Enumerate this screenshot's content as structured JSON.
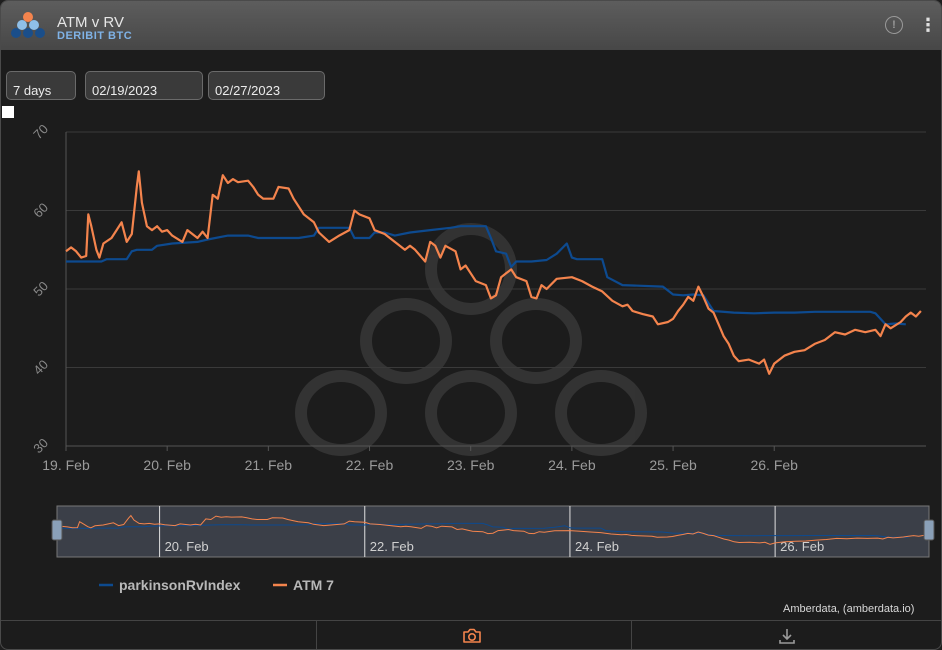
{
  "header": {
    "title": "ATM v RV",
    "subtitle": "DERIBIT BTC",
    "info_symbol": "!",
    "more_symbol": "⋮"
  },
  "controls": {
    "period_value": "7 days",
    "start_date": "02/19/2023",
    "end_date": "02/27/2023"
  },
  "credit": "Amberdata, (amberdata.io)",
  "footer": {
    "camera_icon": "camera-icon",
    "download_icon": "download-icon"
  },
  "colors": {
    "rv": "#0d4a8f",
    "atm": "#f4844d",
    "grid": "#3a3a3a"
  },
  "chart_data": {
    "type": "line",
    "x_unit": "days since 19 Feb 2023 00:00",
    "ylim": [
      30,
      70
    ],
    "y_ticks": [
      30,
      40,
      50,
      60,
      70
    ],
    "x_tick_labels": [
      "19. Feb",
      "20. Feb",
      "21. Feb",
      "22. Feb",
      "23. Feb",
      "24. Feb",
      "25. Feb",
      "26. Feb"
    ],
    "navigator_labels": [
      "20. Feb",
      "22. Feb",
      "24. Feb",
      "26. Feb"
    ],
    "series": [
      {
        "name": "parkinsonRvIndex",
        "color": "#0d4a8f",
        "points": [
          [
            0,
            53.5
          ],
          [
            0.35,
            53.5
          ],
          [
            0.4,
            53.8
          ],
          [
            0.6,
            53.8
          ],
          [
            0.65,
            54.8
          ],
          [
            0.7,
            55
          ],
          [
            0.85,
            55
          ],
          [
            0.9,
            55.5
          ],
          [
            1.05,
            55.8
          ],
          [
            1.3,
            56
          ],
          [
            1.4,
            56.3
          ],
          [
            1.6,
            56.8
          ],
          [
            1.8,
            56.8
          ],
          [
            1.9,
            56.5
          ],
          [
            2.1,
            56.5
          ],
          [
            2.3,
            56.5
          ],
          [
            2.45,
            56.8
          ],
          [
            2.5,
            57.8
          ],
          [
            2.8,
            57.8
          ],
          [
            2.85,
            56.5
          ],
          [
            3.0,
            56.5
          ],
          [
            3.05,
            57.2
          ],
          [
            3.15,
            57.2
          ],
          [
            3.25,
            56.8
          ],
          [
            3.4,
            57.2
          ],
          [
            3.6,
            57.5
          ],
          [
            3.8,
            57.8
          ],
          [
            3.9,
            58
          ],
          [
            4.15,
            58
          ],
          [
            4.2,
            56.5
          ],
          [
            4.25,
            54.8
          ],
          [
            4.35,
            54.5
          ],
          [
            4.4,
            52.8
          ],
          [
            4.45,
            53.5
          ],
          [
            4.6,
            53.5
          ],
          [
            4.75,
            53.7
          ],
          [
            4.85,
            54.5
          ],
          [
            4.95,
            55.8
          ],
          [
            5.0,
            54
          ],
          [
            5.05,
            53.8
          ],
          [
            5.3,
            53.8
          ],
          [
            5.35,
            51.5
          ],
          [
            5.5,
            50.5
          ],
          [
            5.9,
            50.3
          ],
          [
            6.0,
            49.3
          ],
          [
            6.1,
            49.2
          ],
          [
            6.2,
            49.3
          ],
          [
            6.3,
            49.2
          ],
          [
            6.4,
            47.2
          ],
          [
            6.6,
            47
          ],
          [
            6.8,
            46.9
          ],
          [
            7.0,
            47
          ],
          [
            7.2,
            47
          ],
          [
            7.4,
            47.1
          ],
          [
            7.6,
            47.1
          ],
          [
            7.8,
            47.1
          ],
          [
            7.95,
            47.1
          ],
          [
            8.0,
            46.9
          ],
          [
            8.1,
            45.5
          ],
          [
            8.2,
            45.6
          ],
          [
            8.3,
            45.5
          ]
        ]
      },
      {
        "name": "ATM 7",
        "color": "#f4844d",
        "points": [
          [
            0,
            54.8
          ],
          [
            0.05,
            55.3
          ],
          [
            0.1,
            54.8
          ],
          [
            0.15,
            54
          ],
          [
            0.2,
            54.2
          ],
          [
            0.22,
            59.5
          ],
          [
            0.25,
            58
          ],
          [
            0.3,
            55
          ],
          [
            0.33,
            54
          ],
          [
            0.37,
            55.8
          ],
          [
            0.45,
            56.5
          ],
          [
            0.5,
            57.5
          ],
          [
            0.55,
            58.5
          ],
          [
            0.6,
            56
          ],
          [
            0.65,
            57
          ],
          [
            0.7,
            63
          ],
          [
            0.72,
            65
          ],
          [
            0.75,
            61
          ],
          [
            0.8,
            58
          ],
          [
            0.85,
            57.5
          ],
          [
            0.9,
            58
          ],
          [
            0.95,
            57.3
          ],
          [
            1.0,
            57.5
          ],
          [
            1.05,
            56.8
          ],
          [
            1.15,
            56
          ],
          [
            1.2,
            57.5
          ],
          [
            1.3,
            56.5
          ],
          [
            1.35,
            57.3
          ],
          [
            1.4,
            56.5
          ],
          [
            1.45,
            62
          ],
          [
            1.5,
            61.5
          ],
          [
            1.55,
            64.5
          ],
          [
            1.6,
            63.5
          ],
          [
            1.65,
            64
          ],
          [
            1.7,
            63.6
          ],
          [
            1.8,
            63.8
          ],
          [
            1.85,
            63
          ],
          [
            1.9,
            62
          ],
          [
            1.95,
            61.5
          ],
          [
            2.05,
            61.5
          ],
          [
            2.1,
            63
          ],
          [
            2.2,
            62.8
          ],
          [
            2.25,
            61.5
          ],
          [
            2.35,
            59.5
          ],
          [
            2.45,
            58.5
          ],
          [
            2.5,
            57.2
          ],
          [
            2.6,
            56
          ],
          [
            2.7,
            56.8
          ],
          [
            2.8,
            57.5
          ],
          [
            2.85,
            60
          ],
          [
            2.9,
            59.5
          ],
          [
            3.0,
            59
          ],
          [
            3.05,
            57.5
          ],
          [
            3.15,
            57
          ],
          [
            3.25,
            56
          ],
          [
            3.35,
            55
          ],
          [
            3.4,
            55.5
          ],
          [
            3.45,
            55
          ],
          [
            3.55,
            53.5
          ],
          [
            3.6,
            56
          ],
          [
            3.65,
            55.5
          ],
          [
            3.7,
            54
          ],
          [
            3.75,
            55.5
          ],
          [
            3.85,
            54.8
          ],
          [
            3.9,
            52.5
          ],
          [
            3.95,
            53
          ],
          [
            4.0,
            52
          ],
          [
            4.05,
            51
          ],
          [
            4.15,
            50.5
          ],
          [
            4.2,
            48.8
          ],
          [
            4.25,
            49.2
          ],
          [
            4.3,
            51.5
          ],
          [
            4.35,
            52
          ],
          [
            4.4,
            52.5
          ],
          [
            4.45,
            51.5
          ],
          [
            4.55,
            51
          ],
          [
            4.6,
            49
          ],
          [
            4.65,
            48.8
          ],
          [
            4.7,
            50.5
          ],
          [
            4.75,
            50
          ],
          [
            4.85,
            51.3
          ],
          [
            5.0,
            51.5
          ],
          [
            5.1,
            51
          ],
          [
            5.2,
            50.3
          ],
          [
            5.3,
            49.7
          ],
          [
            5.4,
            48.5
          ],
          [
            5.5,
            47.8
          ],
          [
            5.55,
            48
          ],
          [
            5.6,
            47.2
          ],
          [
            5.7,
            46.8
          ],
          [
            5.8,
            46.5
          ],
          [
            5.85,
            45.5
          ],
          [
            5.95,
            45.8
          ],
          [
            6.0,
            46.2
          ],
          [
            6.05,
            47.2
          ],
          [
            6.1,
            48
          ],
          [
            6.15,
            49
          ],
          [
            6.2,
            48.5
          ],
          [
            6.25,
            50.3
          ],
          [
            6.3,
            49
          ],
          [
            6.35,
            47.5
          ],
          [
            6.4,
            47
          ],
          [
            6.45,
            45.5
          ],
          [
            6.5,
            44
          ],
          [
            6.55,
            43
          ],
          [
            6.6,
            41.5
          ],
          [
            6.65,
            40.8
          ],
          [
            6.75,
            41
          ],
          [
            6.85,
            40.5
          ],
          [
            6.9,
            41
          ],
          [
            6.95,
            39.2
          ],
          [
            7.0,
            40.5
          ],
          [
            7.1,
            41.5
          ],
          [
            7.2,
            42
          ],
          [
            7.3,
            42.2
          ],
          [
            7.4,
            43
          ],
          [
            7.5,
            43.5
          ],
          [
            7.6,
            44.5
          ],
          [
            7.7,
            44.2
          ],
          [
            7.8,
            44.8
          ],
          [
            7.9,
            44.5
          ],
          [
            8.0,
            44.8
          ],
          [
            8.05,
            44
          ],
          [
            8.1,
            45.5
          ],
          [
            8.15,
            45
          ],
          [
            8.25,
            45.8
          ],
          [
            8.3,
            46.5
          ],
          [
            8.35,
            47
          ],
          [
            8.4,
            46.5
          ],
          [
            8.45,
            47.2
          ]
        ]
      }
    ]
  }
}
